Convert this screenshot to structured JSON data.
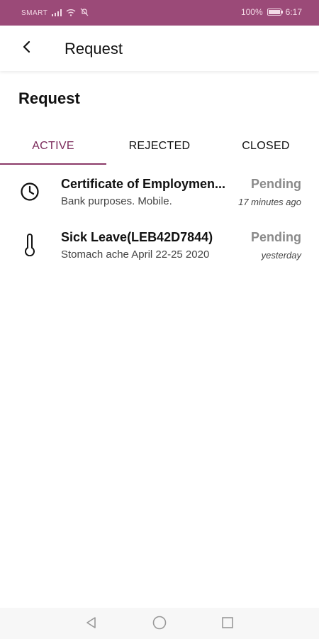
{
  "status_bar": {
    "carrier": "SMART",
    "battery": "100%",
    "time": "6:17"
  },
  "app_bar": {
    "title": "Request"
  },
  "section": {
    "heading": "Request"
  },
  "tabs": [
    {
      "label": "ACTIVE",
      "active": true
    },
    {
      "label": "REJECTED",
      "active": false
    },
    {
      "label": "CLOSED",
      "active": false
    }
  ],
  "requests": [
    {
      "icon": "clock-icon",
      "title": "Certificate of Employmen...",
      "subtitle": "Bank purposes. Mobile.",
      "status": "Pending",
      "time": "17 minutes ago"
    },
    {
      "icon": "thermometer-icon",
      "title": "Sick Leave(LEB42D7844)",
      "subtitle": "Stomach ache April  22-25 2020",
      "status": "Pending",
      "time": "yesterday"
    }
  ],
  "colors": {
    "status_bar": "#9b4a78",
    "accent": "#8b3a68",
    "status_text": "#8a8a8a"
  }
}
